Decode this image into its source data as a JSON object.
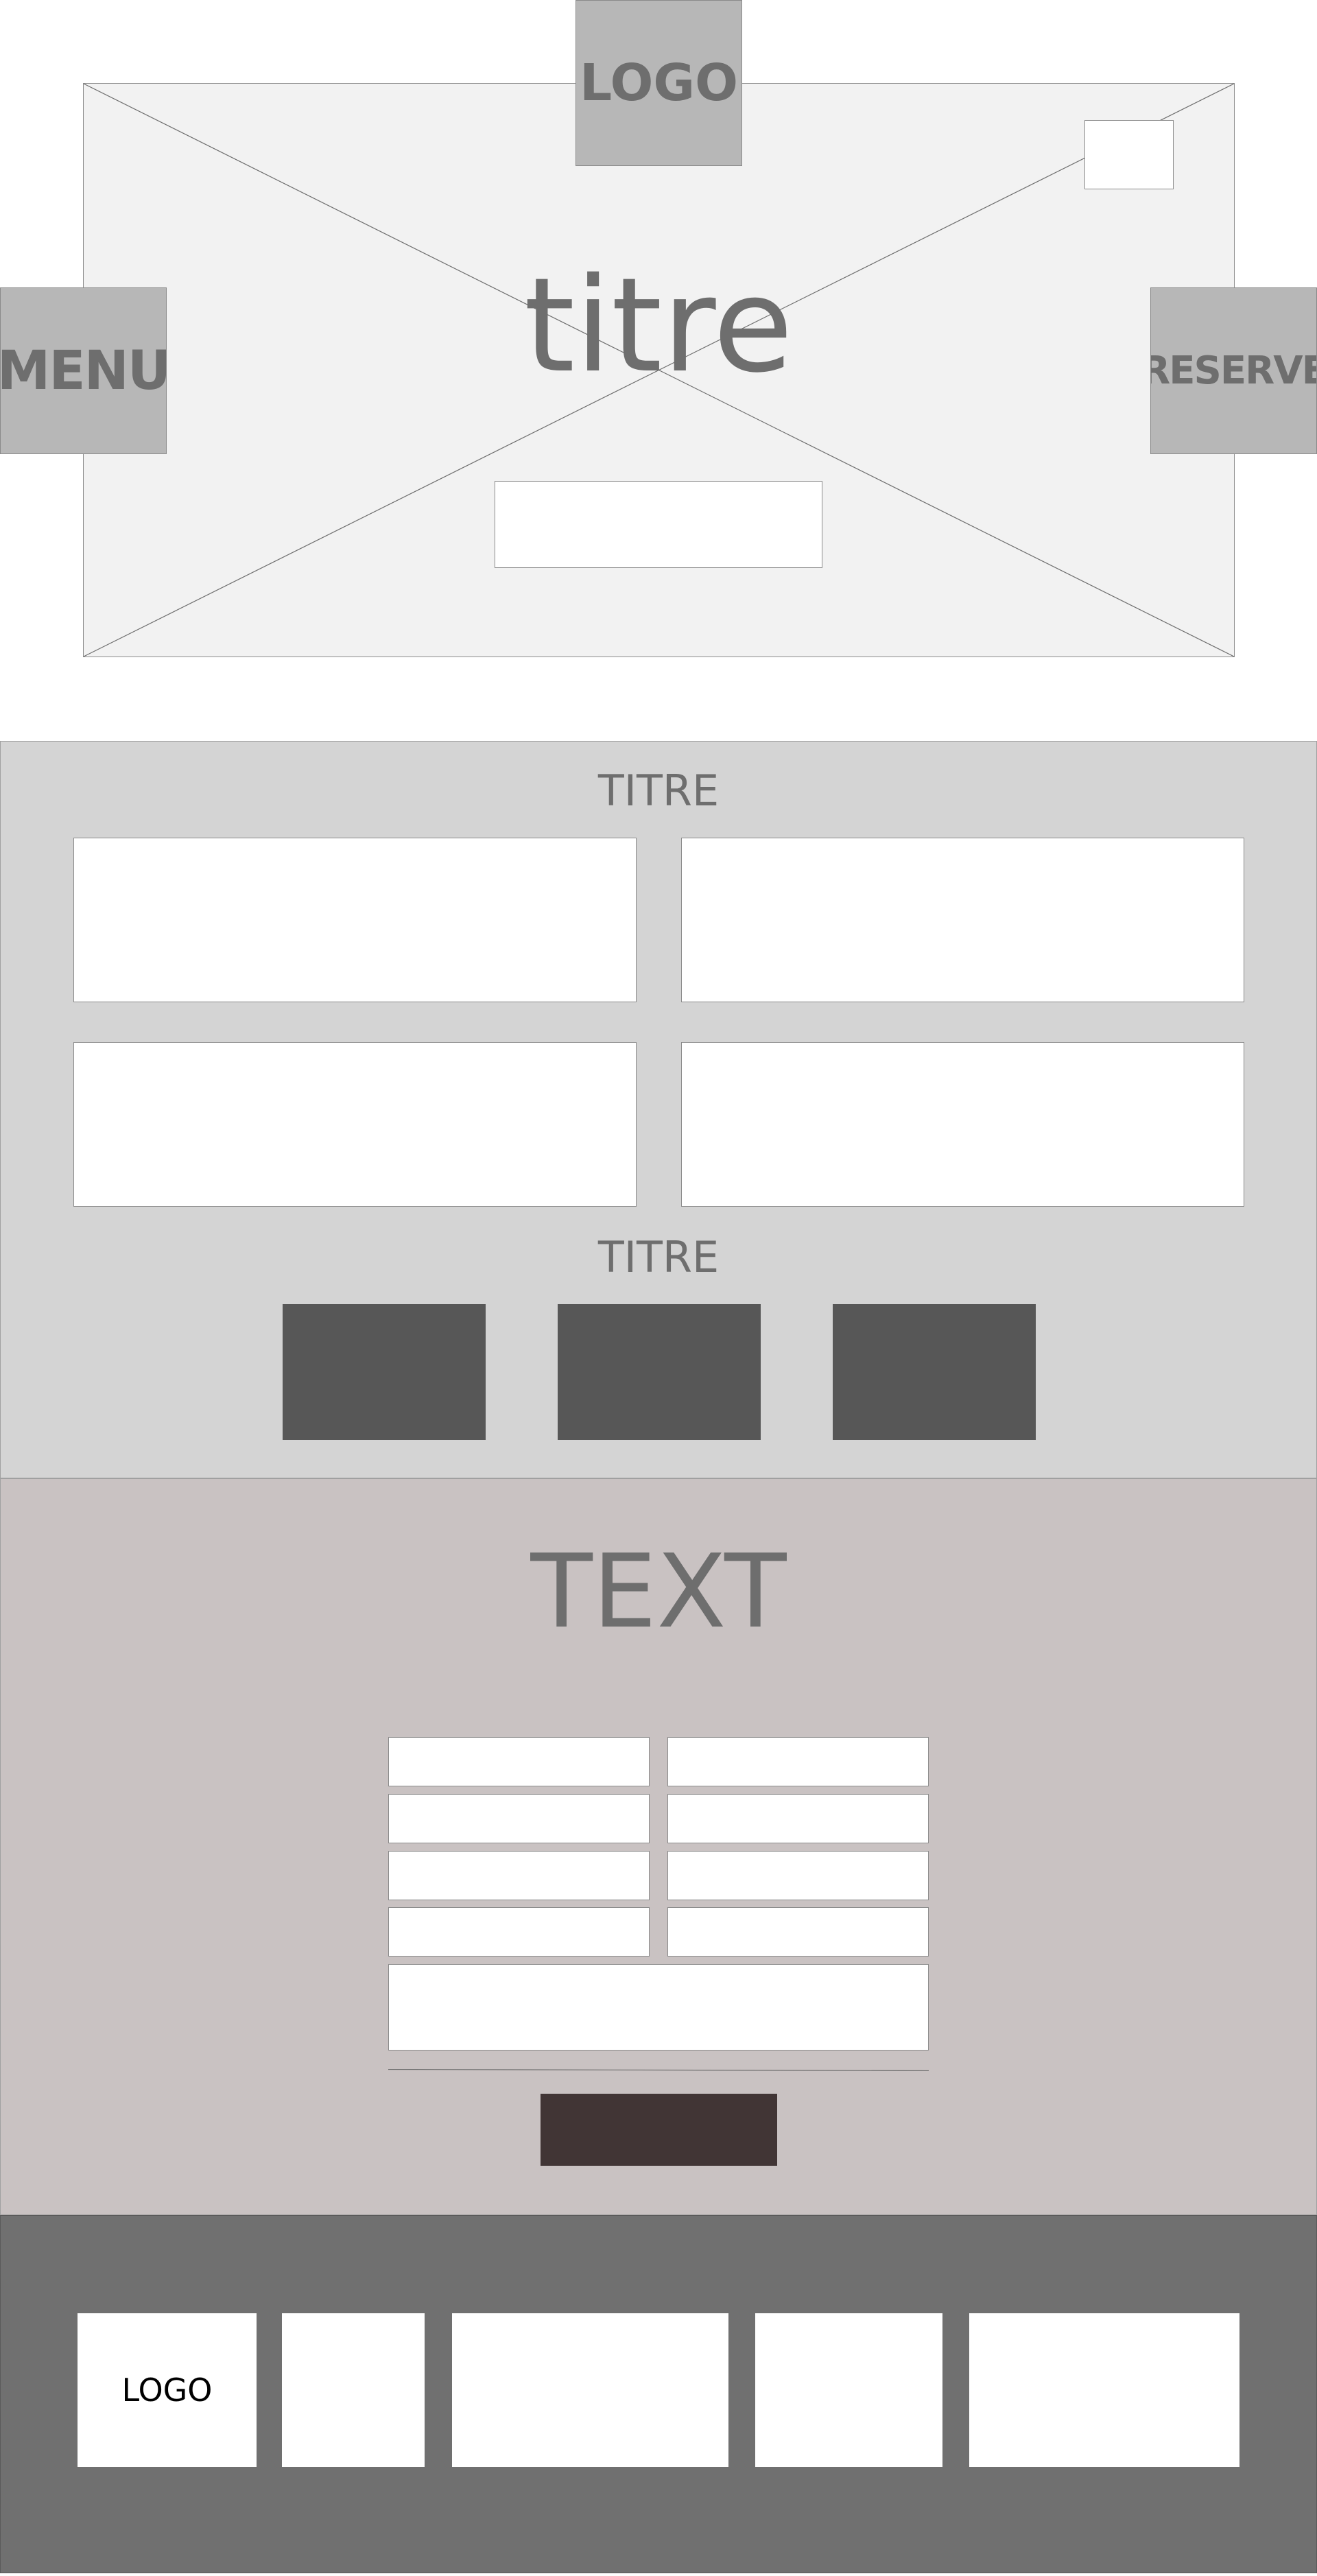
{
  "hero": {
    "logo_label": "LOGO",
    "menu_label": "MENU",
    "reserve_label": "RESERVE",
    "title": "titre"
  },
  "section_two": {
    "title_one": "TITRE",
    "title_two": "TITRE"
  },
  "section_three": {
    "title": "TEXT"
  },
  "footer": {
    "logo_label": "LOGO"
  },
  "colors": {
    "hero_background": "#f2f2f2",
    "tile": "#b7b7b7",
    "section_two_background": "#d4d4d4",
    "dark_block": "#575757",
    "section_three_background": "#c9c2c2",
    "submit_button": "#413535",
    "footer_background": "#707070",
    "label_text": "#6e6e6e"
  }
}
